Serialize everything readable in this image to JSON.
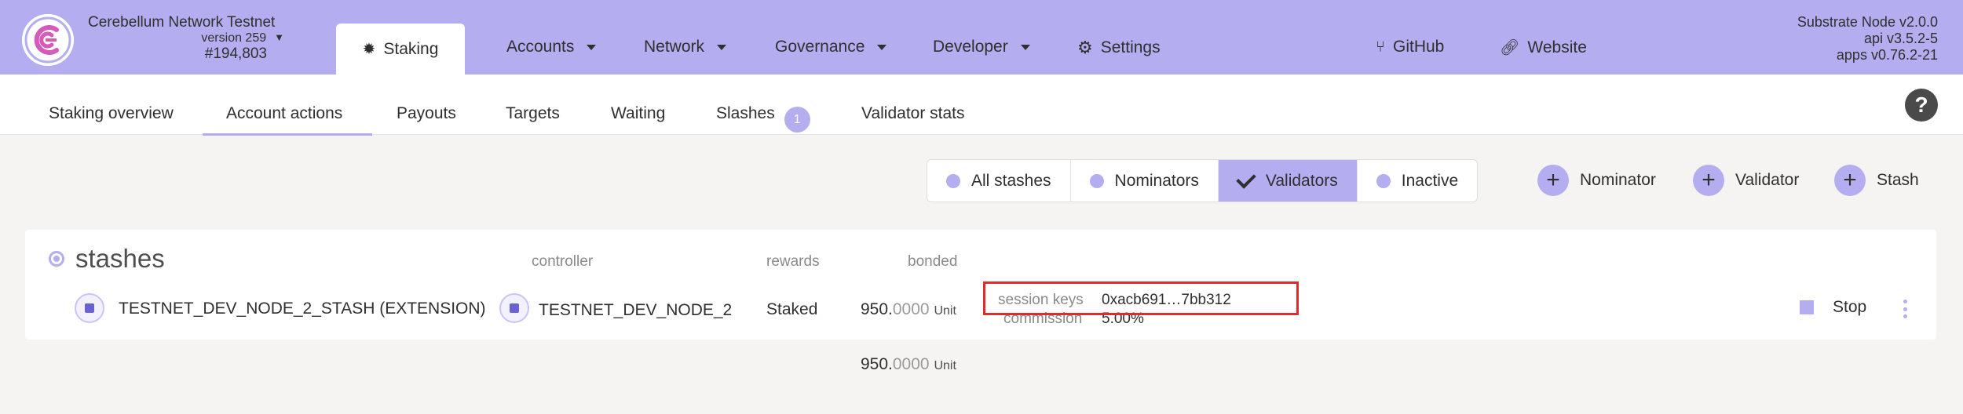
{
  "header": {
    "chain_name": "Cerebellum Network Testnet",
    "version": "version 259",
    "block": "#194,803",
    "active_tab": "Staking",
    "nav": [
      {
        "label": "Accounts"
      },
      {
        "label": "Network"
      },
      {
        "label": "Governance"
      },
      {
        "label": "Developer"
      },
      {
        "label": "Settings"
      },
      {
        "label": "GitHub"
      },
      {
        "label": "Website"
      }
    ],
    "node_info": {
      "line1": "Substrate Node v2.0.0",
      "line2": "api v3.5.2-5",
      "line3": "apps v0.76.2-21"
    }
  },
  "subnav": {
    "items": [
      {
        "label": "Staking overview"
      },
      {
        "label": "Account actions"
      },
      {
        "label": "Payouts"
      },
      {
        "label": "Targets"
      },
      {
        "label": "Waiting"
      },
      {
        "label": "Slashes"
      },
      {
        "label": "Validator stats"
      }
    ],
    "slashes_count": "1",
    "active": "Account actions",
    "help": "?"
  },
  "filters": {
    "items": [
      {
        "label": "All stashes",
        "selected": false
      },
      {
        "label": "Nominators",
        "selected": false
      },
      {
        "label": "Validators",
        "selected": true
      },
      {
        "label": "Inactive",
        "selected": false
      }
    ]
  },
  "actions": {
    "nominator": "Nominator",
    "validator": "Validator",
    "stash": "Stash"
  },
  "stashes": {
    "title": "stashes",
    "columns": {
      "controller": "controller",
      "rewards": "rewards",
      "bonded": "bonded"
    },
    "row": {
      "stash": "TESTNET_DEV_NODE_2_STASH (EXTENSION)",
      "controller": "TESTNET_DEV_NODE_2",
      "rewards": "Staked",
      "bonded_int": "950.",
      "bonded_dec": "0000",
      "bonded_unit": "Unit",
      "session_keys_label": "session keys",
      "session_keys_value": "0xacb691…7bb312",
      "commission_label": "commission",
      "commission_value": "5.00%",
      "stop": "Stop"
    },
    "total": {
      "int": "950.",
      "dec": "0000",
      "unit": "Unit"
    }
  },
  "colors": {
    "accent": "#b4aef0",
    "highlight": "#e02b2b"
  }
}
